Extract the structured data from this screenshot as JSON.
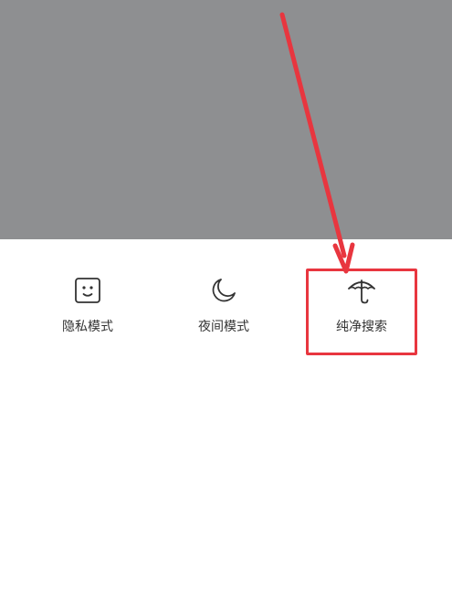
{
  "sheet": {
    "options": [
      {
        "label": "隐私模式",
        "icon": "privacy-face-icon"
      },
      {
        "label": "夜间模式",
        "icon": "moon-icon"
      },
      {
        "label": "纯净搜索",
        "icon": "umbrella-icon"
      }
    ]
  },
  "annotation": {
    "color": "#e8363f"
  },
  "colors": {
    "overlay": "#8e8f91",
    "sheet": "#ffffff",
    "text": "#333333",
    "icon": "#333333"
  }
}
